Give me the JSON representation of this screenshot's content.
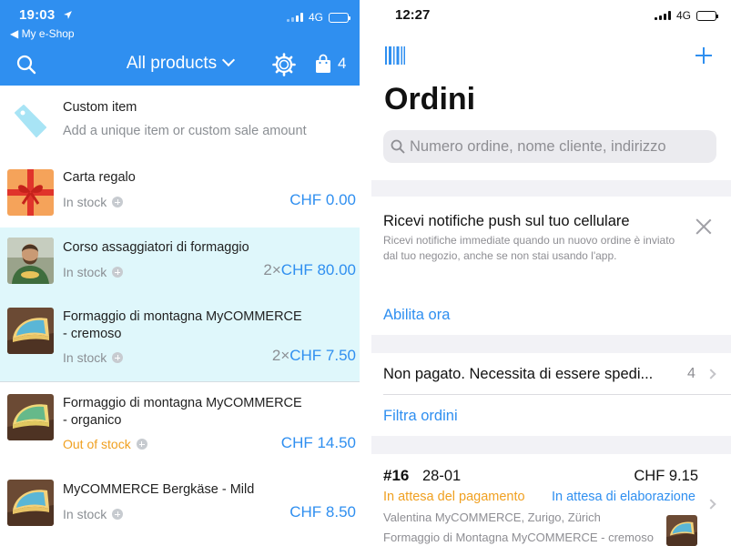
{
  "left": {
    "status": {
      "time": "19:03",
      "back_label": "◀ My e-Shop",
      "network": "4G"
    },
    "header": {
      "title": "All products",
      "cart_count": "4"
    },
    "items": [
      {
        "name": "Custom item",
        "subtitle": "Add a unique item or custom sale amount"
      },
      {
        "name": "Carta regalo",
        "stock": "In stock",
        "qty": "",
        "price": "CHF 0.00"
      },
      {
        "name": "Corso assaggiatori di formaggio",
        "stock": "In stock",
        "qty": "2×",
        "price": "CHF 80.00"
      },
      {
        "name_line1": "Formaggio di montagna MyCOMMERCE",
        "name_line2": "- cremoso",
        "stock": "In stock",
        "qty": "2×",
        "price": "CHF 7.50"
      },
      {
        "name_line1": "Formaggio di montagna MyCOMMERCE",
        "name_line2": "- organico",
        "stock": "Out of stock",
        "qty": "",
        "price": "CHF 14.50"
      },
      {
        "name": "MyCOMMERCE Bergkäse - Mild",
        "stock": "In stock",
        "qty": "",
        "price": "CHF 8.50"
      }
    ],
    "colors": {
      "accent": "#2f8ff0",
      "highlight": "#dff7fb",
      "out_of_stock": "#f0a020"
    }
  },
  "right": {
    "status": {
      "time": "12:27",
      "network": "4G"
    },
    "title": "Ordini",
    "search": {
      "placeholder": "Numero ordine, nome cliente, indirizzo"
    },
    "push": {
      "title": "Ricevi notifiche push sul tuo cellulare",
      "body": "Ricevi notifiche immediate quando un nuovo ordine è inviato dal tuo negozio, anche se non stai usando l'app.",
      "action": "Abilita ora"
    },
    "filter": {
      "label": "Non pagato. Necessita di essere spedi...",
      "count": "4",
      "link": "Filtra ordini"
    },
    "order": {
      "number": "#16",
      "date": "28-01",
      "amount": "CHF 9.15",
      "payment_status": "In attesa del pagamento",
      "processing_status": "In attesa di elaborazione",
      "customer": "Valentina MyCOMMERCE, Zurigo, Zürich",
      "product": "Formaggio di Montagna MyCOMMERCE - cremoso"
    }
  }
}
